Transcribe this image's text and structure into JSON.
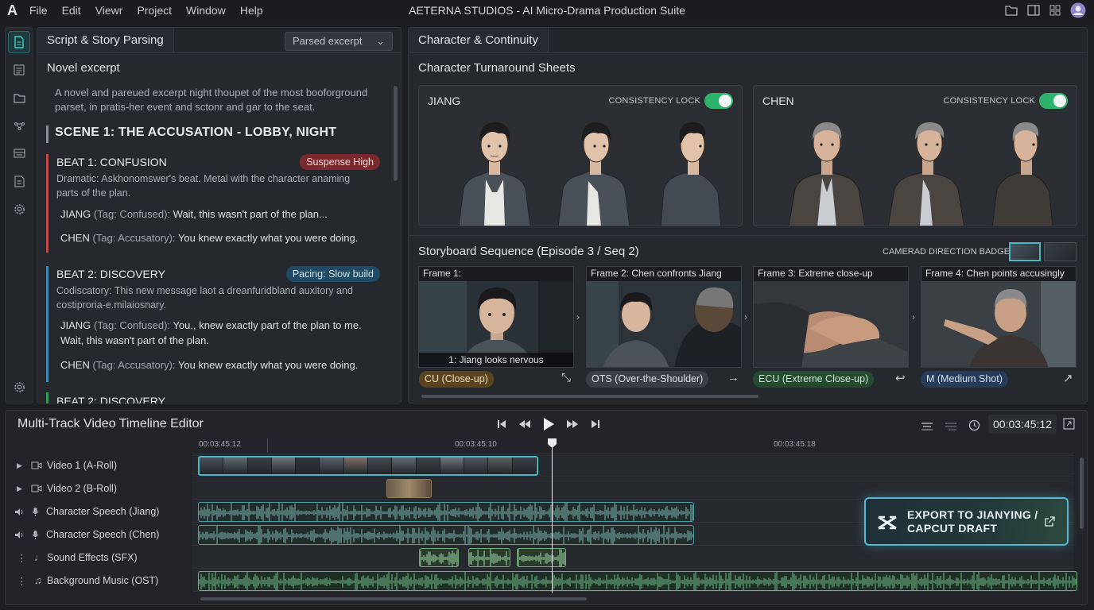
{
  "menu": {
    "logo": "A",
    "items": [
      "File",
      "Edit",
      "Viewr",
      "Project",
      "Window",
      "Help"
    ],
    "title": "AETERNA STUDIOS - AI Micro-Drama Production Suite"
  },
  "script_panel": {
    "tab": "Script & Story Parsing",
    "section_label": "Novel excerpt",
    "dropdown_value": "Parsed excerpt",
    "excerpt": "A novel and pareued excerpt night thoupet of the most booforground parset, in pratis-her event and sctonr and gar to the seat.",
    "scene": "SCENE 1: THE ACCUSATION - LOBBY, NIGHT",
    "beats": [
      {
        "title": "BEAT 1: CONFUSION",
        "badge": "Suspense High",
        "badge_color": "#7a2a2e",
        "accent": "#c0474a",
        "desc": "Dramatic: Askhonomswer's beat. Metal with the character anaming parts of the plan.",
        "lines": [
          {
            "speaker": "JIANG",
            "tag": "(Tag: Confused):",
            "text": "Wait, this wasn't part of the plan..."
          },
          {
            "speaker": "CHEN",
            "tag": "(Tag: Accusatory):",
            "text": "You knew exactly what you were doing."
          }
        ]
      },
      {
        "title": "BEAT 2: DISCOVERY",
        "badge": "Pacing: Slow build",
        "badge_color": "#1f4a63",
        "accent": "#3d87b3",
        "desc": "Codiscatory: This new message laot a dreanfuridbland auxitory and costiproria-e.milaiosnary.",
        "lines": [
          {
            "speaker": "JIANG",
            "tag": "(Tag: Confused):",
            "text": "You., knew exactly part of the plan to me. Wait, this wasn't part of the plan."
          },
          {
            "speaker": "CHEN",
            "tag": "(Tag: Accusatory):",
            "text": "You knew exactly what you were doing."
          }
        ]
      },
      {
        "title": "BEAT 2: DISCOVERY"
      }
    ]
  },
  "character_panel": {
    "tab": "Character & Continuity",
    "turnaround_title": "Character Turnaround Sheets",
    "characters": [
      {
        "name": "JIANG",
        "lock_label": "CONSISTENCY LOCK"
      },
      {
        "name": "CHEN",
        "lock_label": "CONSISTENCY LOCK"
      }
    ],
    "storyboard_title": "Storyboard Sequence (Episode 3 / Seq 2)",
    "camera_badges_label": "CAMERAD DIRECTION BADGES",
    "frames": [
      {
        "title": "Frame 1:",
        "caption": "1: Jiang looks nervous",
        "shot": "CU (Close-up)",
        "shot_color": "#5a4420",
        "arrow": "⤡"
      },
      {
        "title": "Frame 2: Chen confronts Jiang",
        "caption": "",
        "shot": "OTS (Over-the-Shoulder)",
        "shot_color": "#3a3e45",
        "arrow": "→"
      },
      {
        "title": "Frame 3: Extreme close-up",
        "caption": "",
        "shot": "ECU (Extreme Close-up)",
        "shot_color": "#254a32",
        "arrow": "↩"
      },
      {
        "title": "Frame 4: Chen points accusingly",
        "caption": "",
        "shot": "M (Medium Shot)",
        "shot_color": "#263c5a",
        "arrow": "↗"
      }
    ]
  },
  "timeline": {
    "title": "Multi-Track Video Timeline Editor",
    "timecode": "00:03:45:12",
    "ruler": [
      "00:03:45:12",
      "00:03:45:10",
      "00:03:45:18"
    ],
    "tracks": [
      {
        "name": "Video 1 (A-Roll)",
        "icon": "camera-icon"
      },
      {
        "name": "Video 2 (B-Roll)",
        "icon": "camera-icon"
      },
      {
        "name": "Character Speech (Jiang)",
        "icon": "microphone-icon"
      },
      {
        "name": "Character Speech (Chen)",
        "icon": "microphone-icon"
      },
      {
        "name": "Sound Effects (SFX)",
        "icon": "note-icon"
      },
      {
        "name": "Background Music (OST)",
        "icon": "music-icon"
      }
    ],
    "export_label": "EXPORT TO JIANYING / CAPCUT DRAFT"
  },
  "colors": {
    "accent": "#2fb36c",
    "export_border": "#58b6d0"
  }
}
